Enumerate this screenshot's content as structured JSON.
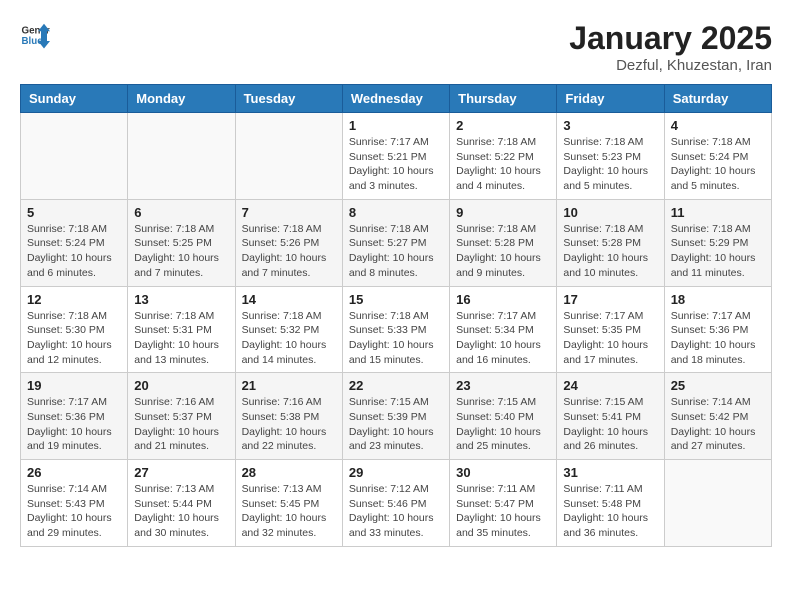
{
  "header": {
    "logo_general": "General",
    "logo_blue": "Blue",
    "month_title": "January 2025",
    "location": "Dezful, Khuzestan, Iran"
  },
  "weekdays": [
    "Sunday",
    "Monday",
    "Tuesday",
    "Wednesday",
    "Thursday",
    "Friday",
    "Saturday"
  ],
  "weeks": [
    [
      {
        "day": "",
        "info": ""
      },
      {
        "day": "",
        "info": ""
      },
      {
        "day": "",
        "info": ""
      },
      {
        "day": "1",
        "info": "Sunrise: 7:17 AM\nSunset: 5:21 PM\nDaylight: 10 hours\nand 3 minutes."
      },
      {
        "day": "2",
        "info": "Sunrise: 7:18 AM\nSunset: 5:22 PM\nDaylight: 10 hours\nand 4 minutes."
      },
      {
        "day": "3",
        "info": "Sunrise: 7:18 AM\nSunset: 5:23 PM\nDaylight: 10 hours\nand 5 minutes."
      },
      {
        "day": "4",
        "info": "Sunrise: 7:18 AM\nSunset: 5:24 PM\nDaylight: 10 hours\nand 5 minutes."
      }
    ],
    [
      {
        "day": "5",
        "info": "Sunrise: 7:18 AM\nSunset: 5:24 PM\nDaylight: 10 hours\nand 6 minutes."
      },
      {
        "day": "6",
        "info": "Sunrise: 7:18 AM\nSunset: 5:25 PM\nDaylight: 10 hours\nand 7 minutes."
      },
      {
        "day": "7",
        "info": "Sunrise: 7:18 AM\nSunset: 5:26 PM\nDaylight: 10 hours\nand 7 minutes."
      },
      {
        "day": "8",
        "info": "Sunrise: 7:18 AM\nSunset: 5:27 PM\nDaylight: 10 hours\nand 8 minutes."
      },
      {
        "day": "9",
        "info": "Sunrise: 7:18 AM\nSunset: 5:28 PM\nDaylight: 10 hours\nand 9 minutes."
      },
      {
        "day": "10",
        "info": "Sunrise: 7:18 AM\nSunset: 5:28 PM\nDaylight: 10 hours\nand 10 minutes."
      },
      {
        "day": "11",
        "info": "Sunrise: 7:18 AM\nSunset: 5:29 PM\nDaylight: 10 hours\nand 11 minutes."
      }
    ],
    [
      {
        "day": "12",
        "info": "Sunrise: 7:18 AM\nSunset: 5:30 PM\nDaylight: 10 hours\nand 12 minutes."
      },
      {
        "day": "13",
        "info": "Sunrise: 7:18 AM\nSunset: 5:31 PM\nDaylight: 10 hours\nand 13 minutes."
      },
      {
        "day": "14",
        "info": "Sunrise: 7:18 AM\nSunset: 5:32 PM\nDaylight: 10 hours\nand 14 minutes."
      },
      {
        "day": "15",
        "info": "Sunrise: 7:18 AM\nSunset: 5:33 PM\nDaylight: 10 hours\nand 15 minutes."
      },
      {
        "day": "16",
        "info": "Sunrise: 7:17 AM\nSunset: 5:34 PM\nDaylight: 10 hours\nand 16 minutes."
      },
      {
        "day": "17",
        "info": "Sunrise: 7:17 AM\nSunset: 5:35 PM\nDaylight: 10 hours\nand 17 minutes."
      },
      {
        "day": "18",
        "info": "Sunrise: 7:17 AM\nSunset: 5:36 PM\nDaylight: 10 hours\nand 18 minutes."
      }
    ],
    [
      {
        "day": "19",
        "info": "Sunrise: 7:17 AM\nSunset: 5:36 PM\nDaylight: 10 hours\nand 19 minutes."
      },
      {
        "day": "20",
        "info": "Sunrise: 7:16 AM\nSunset: 5:37 PM\nDaylight: 10 hours\nand 21 minutes."
      },
      {
        "day": "21",
        "info": "Sunrise: 7:16 AM\nSunset: 5:38 PM\nDaylight: 10 hours\nand 22 minutes."
      },
      {
        "day": "22",
        "info": "Sunrise: 7:15 AM\nSunset: 5:39 PM\nDaylight: 10 hours\nand 23 minutes."
      },
      {
        "day": "23",
        "info": "Sunrise: 7:15 AM\nSunset: 5:40 PM\nDaylight: 10 hours\nand 25 minutes."
      },
      {
        "day": "24",
        "info": "Sunrise: 7:15 AM\nSunset: 5:41 PM\nDaylight: 10 hours\nand 26 minutes."
      },
      {
        "day": "25",
        "info": "Sunrise: 7:14 AM\nSunset: 5:42 PM\nDaylight: 10 hours\nand 27 minutes."
      }
    ],
    [
      {
        "day": "26",
        "info": "Sunrise: 7:14 AM\nSunset: 5:43 PM\nDaylight: 10 hours\nand 29 minutes."
      },
      {
        "day": "27",
        "info": "Sunrise: 7:13 AM\nSunset: 5:44 PM\nDaylight: 10 hours\nand 30 minutes."
      },
      {
        "day": "28",
        "info": "Sunrise: 7:13 AM\nSunset: 5:45 PM\nDaylight: 10 hours\nand 32 minutes."
      },
      {
        "day": "29",
        "info": "Sunrise: 7:12 AM\nSunset: 5:46 PM\nDaylight: 10 hours\nand 33 minutes."
      },
      {
        "day": "30",
        "info": "Sunrise: 7:11 AM\nSunset: 5:47 PM\nDaylight: 10 hours\nand 35 minutes."
      },
      {
        "day": "31",
        "info": "Sunrise: 7:11 AM\nSunset: 5:48 PM\nDaylight: 10 hours\nand 36 minutes."
      },
      {
        "day": "",
        "info": ""
      }
    ]
  ]
}
